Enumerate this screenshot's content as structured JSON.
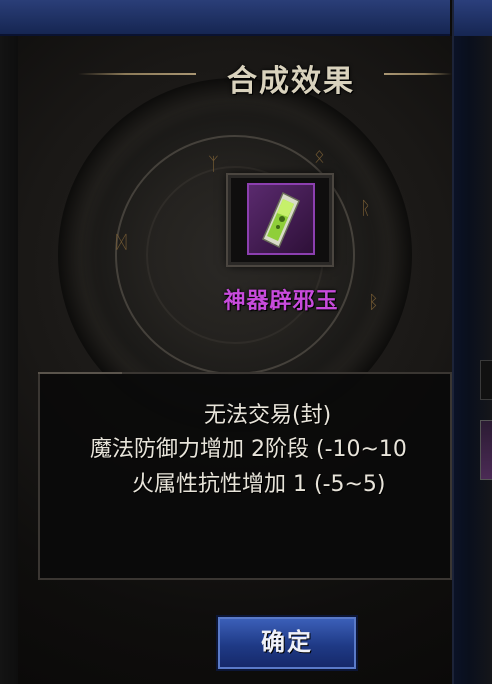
{
  "dialog": {
    "title": "合成效果",
    "confirm_label": "确定"
  },
  "item": {
    "name": "神器辟邪玉",
    "icon": "jade-card-icon",
    "name_color": "#c84bdc",
    "frame_color": "#8c3fb0"
  },
  "tooltip": {
    "line1": "无法交易(封)",
    "line2": "魔法防御力增加 2阶段 (-10~10",
    "line3": "火属性抗性增加 1 (-5~5)"
  },
  "colors": {
    "title_bar": "#22346a",
    "button": "#2a4a9e",
    "text": "#e8e4da"
  }
}
